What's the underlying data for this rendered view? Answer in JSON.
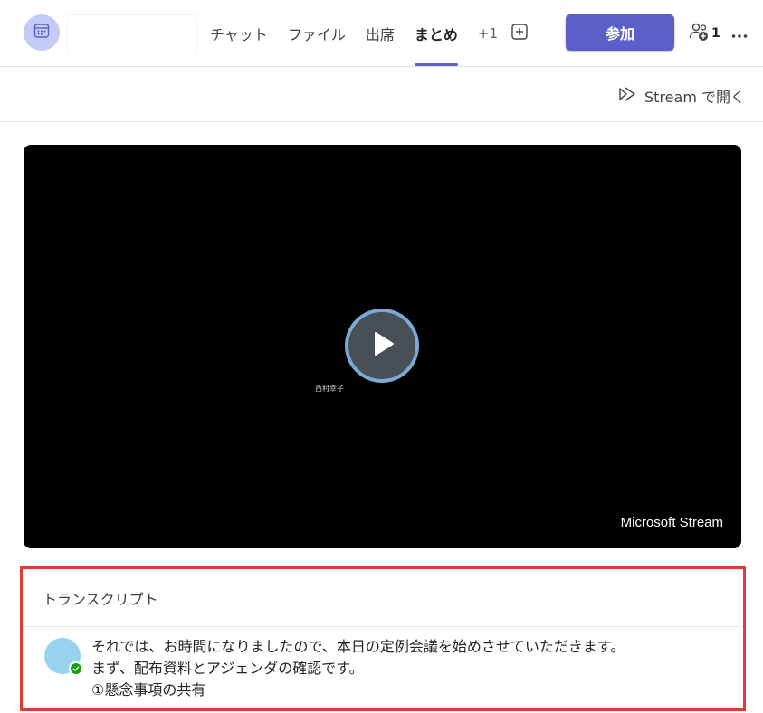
{
  "header": {
    "tabs": [
      {
        "label": "チャット",
        "active": false
      },
      {
        "label": "ファイル",
        "active": false
      },
      {
        "label": "出席",
        "active": false
      },
      {
        "label": "まとめ",
        "active": true
      }
    ],
    "more_tabs_label": "+1",
    "join_label": "参加",
    "participant_count": "1",
    "icons": {
      "meeting": "calendar-icon",
      "add_tab": "add-square-icon",
      "participants": "people-add-icon",
      "more": "more-horizontal-icon"
    }
  },
  "subbar": {
    "open_in_stream_label": "Stream で開く",
    "icon": "stream-video-icon"
  },
  "video": {
    "speaker_name": "西村幸子",
    "watermark": "Microsoft Stream",
    "play_icon": "play-icon"
  },
  "transcript": {
    "title": "トランスクリプト",
    "entries": [
      {
        "presence": "available",
        "lines": [
          "それでは、お時間になりましたので、本日の定例会議を始めさせていただきます。",
          "まず、配布資料とアジェンダの確認です。",
          "①懸念事項の共有"
        ]
      }
    ]
  },
  "colors": {
    "accent": "#5b5fc7",
    "highlight_border": "#e53935",
    "presence_available": "#13a10e",
    "avatar_meeting": "#c5cbf7",
    "avatar_speaker": "#98d3ee"
  }
}
